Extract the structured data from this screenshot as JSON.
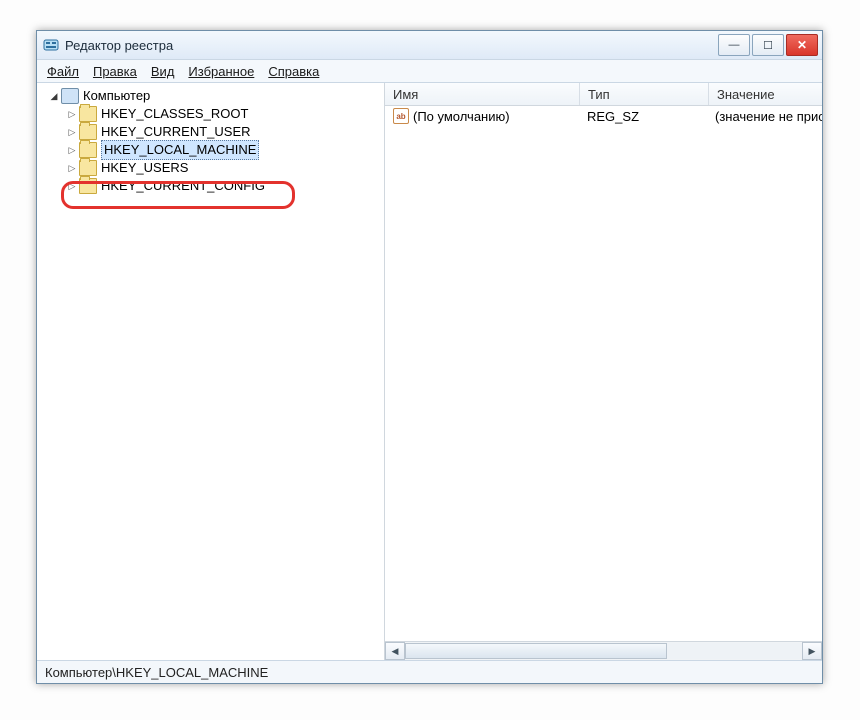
{
  "window": {
    "title": "Редактор реестра"
  },
  "menu": {
    "file": "Файл",
    "edit": "Правка",
    "view": "Вид",
    "favorites": "Избранное",
    "help": "Справка"
  },
  "tree": {
    "root": "Компьютер",
    "items": [
      "HKEY_CLASSES_ROOT",
      "HKEY_CURRENT_USER",
      "HKEY_LOCAL_MACHINE",
      "HKEY_USERS",
      "HKEY_CURRENT_CONFIG"
    ]
  },
  "list": {
    "headers": {
      "name": "Имя",
      "type": "Тип",
      "value": "Значение"
    },
    "rows": [
      {
        "name": "(По умолчанию)",
        "type": "REG_SZ",
        "value": "(значение не присво"
      }
    ]
  },
  "icons": {
    "value_badge": "ab"
  },
  "statusbar": "Компьютер\\HKEY_LOCAL_MACHINE",
  "glyph": {
    "tri_right": "▷",
    "tri_down": "◢",
    "min": "—",
    "max": "☐",
    "close": "✕",
    "left": "◀",
    "right": "▶"
  }
}
